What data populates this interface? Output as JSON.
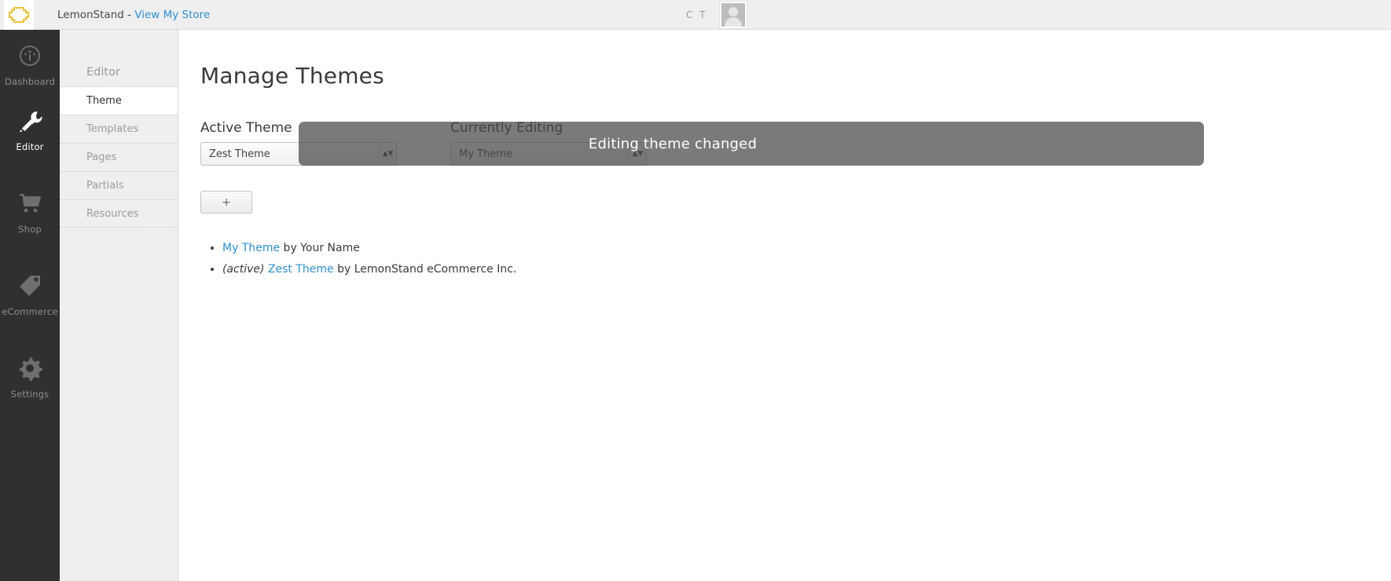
{
  "header": {
    "logo_icon": "lemonstand-logo-icon",
    "brand": "LemonStand - ",
    "store_link": "View My Store",
    "user_initials": "C T",
    "avatar_icon": "user-avatar-placeholder"
  },
  "rail": {
    "items": [
      {
        "label": "Dashboard",
        "icon": "gauge-icon",
        "active": false
      },
      {
        "label": "Editor",
        "icon": "tools-icon",
        "active": true
      },
      {
        "label": "Shop",
        "icon": "shopping-cart-icon",
        "active": false
      },
      {
        "label": "eCommerce",
        "icon": "price-tag-icon",
        "active": false
      },
      {
        "label": "Settings",
        "icon": "gear-icon",
        "active": false
      }
    ]
  },
  "subnav": {
    "title": "Editor",
    "items": [
      {
        "label": "Theme",
        "active": true
      },
      {
        "label": "Templates",
        "active": false
      },
      {
        "label": "Pages",
        "active": false
      },
      {
        "label": "Partials",
        "active": false
      },
      {
        "label": "Resources",
        "active": false
      }
    ]
  },
  "main": {
    "page_title": "Manage Themes",
    "active_theme": {
      "label": "Active Theme",
      "selected": "Zest Theme"
    },
    "currently_editing": {
      "label": "Currently Editing",
      "selected": "My Theme"
    },
    "add_button_label": "+",
    "themes": [
      {
        "active_prefix": "",
        "name": "My Theme",
        "by": " by Your Name"
      },
      {
        "active_prefix": "(active) ",
        "name": "Zest Theme",
        "by": " by LemonStand eCommerce Inc."
      }
    ]
  },
  "overlay": {
    "message": "Editing theme changed"
  },
  "colors": {
    "rail_bg": "#303030",
    "subnav_bg": "#efefef",
    "link_blue": "#2f8fce",
    "logo_yellow": "#e8c23a",
    "overlay_gray": "#464646"
  }
}
